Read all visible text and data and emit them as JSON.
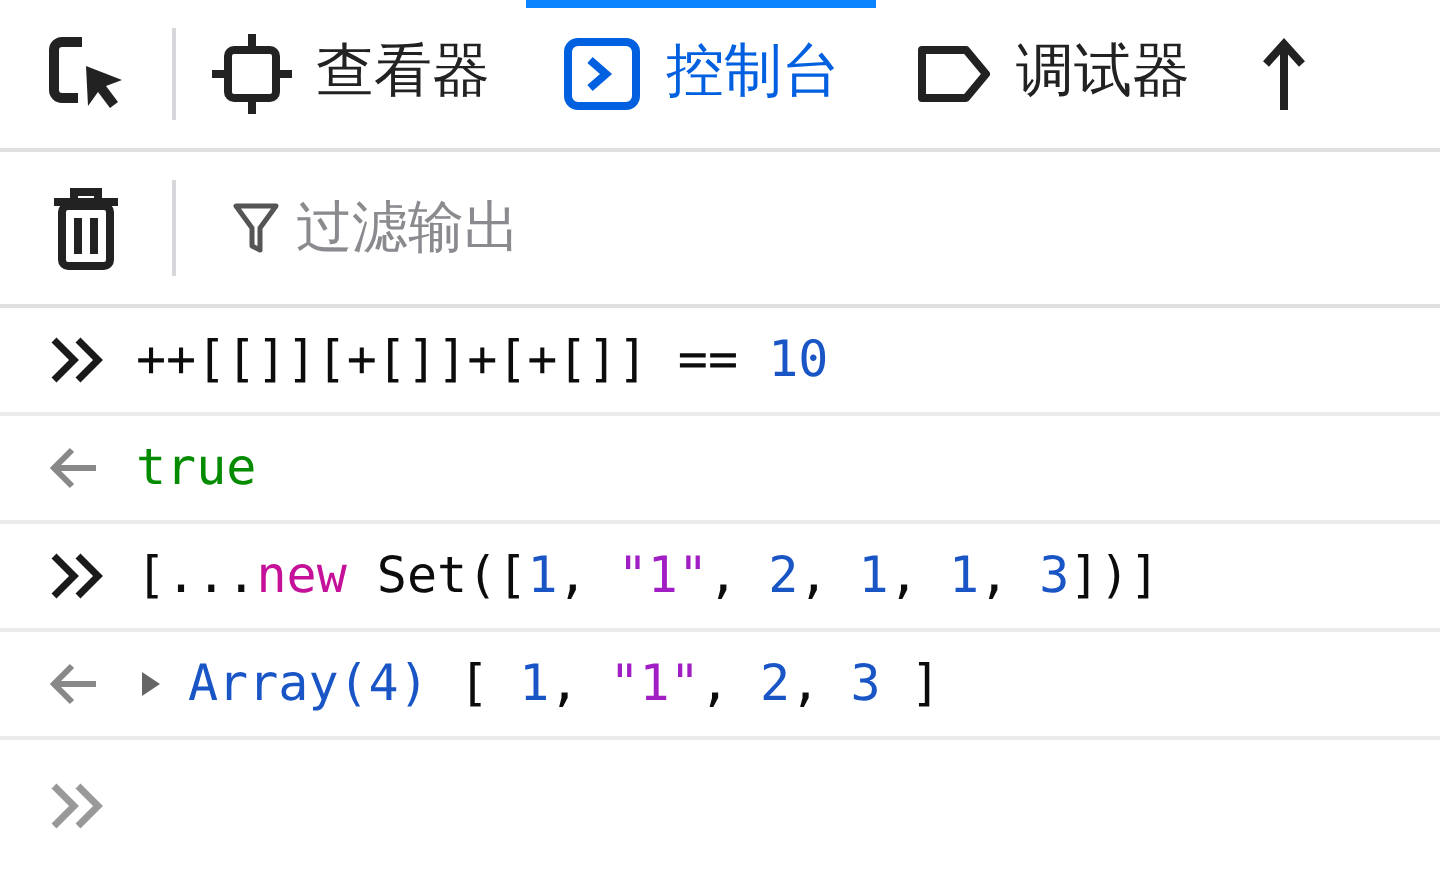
{
  "toolbar": {
    "tabs": [
      {
        "label": "查看器",
        "kind": "inspector",
        "selected": false
      },
      {
        "label": "控制台",
        "kind": "console",
        "selected": true
      },
      {
        "label": "调试器",
        "kind": "debugger",
        "selected": false
      }
    ]
  },
  "filter": {
    "placeholder": "过滤输出"
  },
  "messages": [
    {
      "kind": "input",
      "tokens": [
        {
          "text": "++[[]][+[]]+[+[]] == ",
          "kind": "plain"
        },
        {
          "text": "10",
          "kind": "number"
        }
      ]
    },
    {
      "kind": "result",
      "tokens": [
        {
          "text": "true",
          "kind": "boolean"
        }
      ]
    },
    {
      "kind": "input",
      "tokens": [
        {
          "text": "[...",
          "kind": "plain"
        },
        {
          "text": "new",
          "kind": "keyword"
        },
        {
          "text": " Set([",
          "kind": "plain"
        },
        {
          "text": "1",
          "kind": "number"
        },
        {
          "text": ", ",
          "kind": "plain"
        },
        {
          "text": "\"1\"",
          "kind": "string"
        },
        {
          "text": ", ",
          "kind": "plain"
        },
        {
          "text": "2",
          "kind": "number"
        },
        {
          "text": ", ",
          "kind": "plain"
        },
        {
          "text": "1",
          "kind": "number"
        },
        {
          "text": ", ",
          "kind": "plain"
        },
        {
          "text": "1",
          "kind": "number"
        },
        {
          "text": ", ",
          "kind": "plain"
        },
        {
          "text": "3",
          "kind": "number"
        },
        {
          "text": "])]",
          "kind": "plain"
        }
      ]
    },
    {
      "kind": "object",
      "expanded": false,
      "tokens": [
        {
          "text": "Array(4)",
          "kind": "class"
        },
        {
          "text": " [ ",
          "kind": "bracket"
        },
        {
          "text": "1",
          "kind": "number"
        },
        {
          "text": ", ",
          "kind": "plain"
        },
        {
          "text": "\"1\"",
          "kind": "string"
        },
        {
          "text": ", ",
          "kind": "plain"
        },
        {
          "text": "2",
          "kind": "number"
        },
        {
          "text": ", ",
          "kind": "plain"
        },
        {
          "text": "3",
          "kind": "number"
        },
        {
          "text": " ]",
          "kind": "bracket"
        }
      ]
    }
  ]
}
